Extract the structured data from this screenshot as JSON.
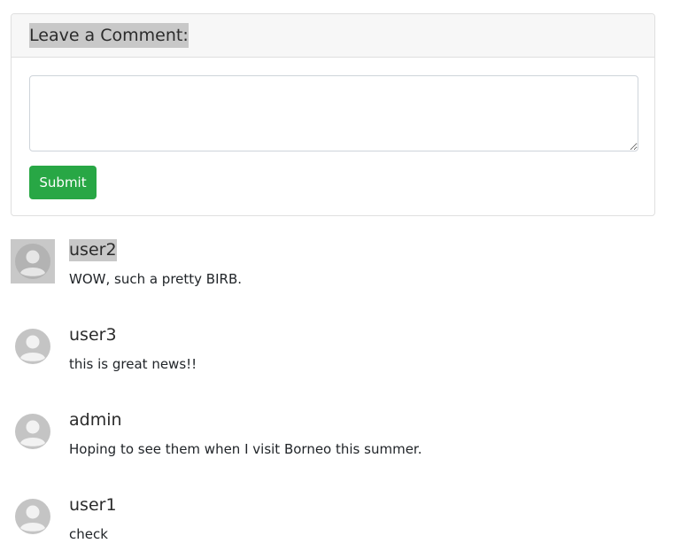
{
  "comment_form": {
    "title": "Leave a Comment:",
    "textarea_value": "",
    "submit_label": "Submit",
    "submit_color": "#28a745"
  },
  "comments": [
    {
      "author": "user2",
      "text": "WOW, such a pretty BIRB.",
      "avatar_icon": "user-avatar-icon",
      "selected": true
    },
    {
      "author": "user3",
      "text": "this is great news!!",
      "avatar_icon": "user-avatar-icon",
      "selected": false
    },
    {
      "author": "admin",
      "text": "Hoping to see them when I visit Borneo this summer.",
      "avatar_icon": "user-avatar-icon",
      "selected": false
    },
    {
      "author": "user1",
      "text": "check",
      "avatar_icon": "user-avatar-icon",
      "selected": false
    }
  ],
  "colors": {
    "avatar_gray": "#c4c4c4",
    "selection_highlight": "#c8c8c8"
  }
}
